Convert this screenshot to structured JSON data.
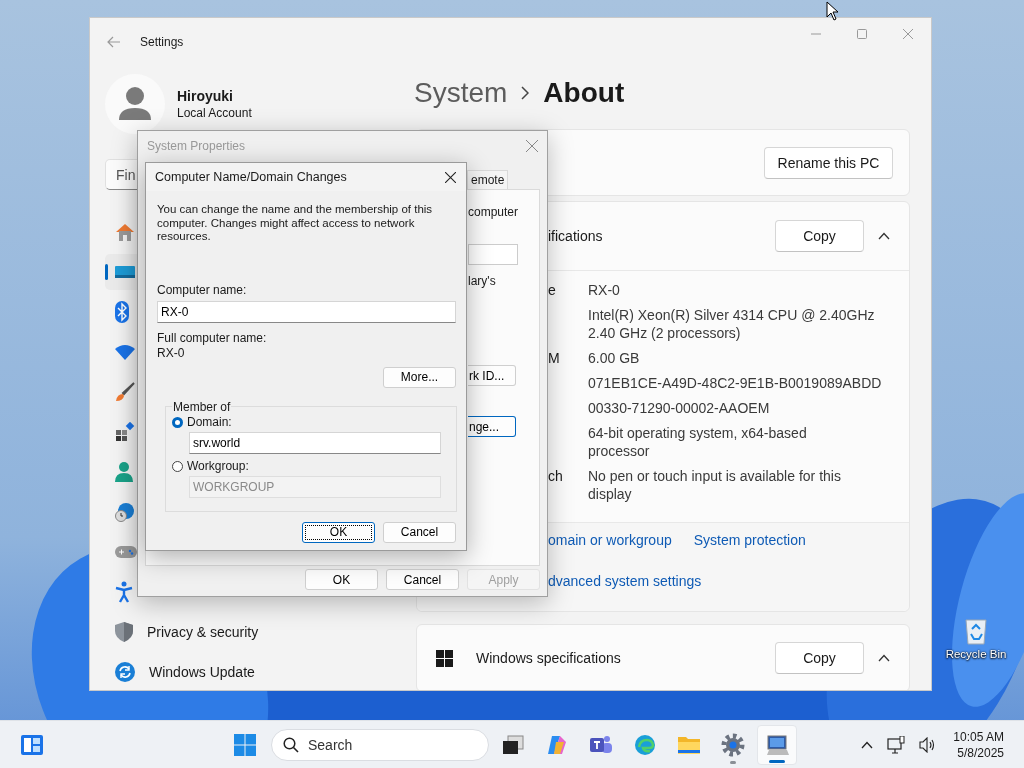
{
  "desktop": {
    "icons": [
      {
        "label": "Recycle Bin"
      }
    ]
  },
  "settings": {
    "title": "Settings",
    "user": {
      "name": "Hiroyuki",
      "account": "Local Account"
    },
    "search": {
      "placeholder": "Fin"
    },
    "nav": [
      {
        "kind": "home",
        "selected": false
      },
      {
        "kind": "system",
        "selected": true
      },
      {
        "kind": "bluetooth",
        "selected": false
      },
      {
        "kind": "network",
        "selected": false
      },
      {
        "kind": "personalization",
        "selected": false
      },
      {
        "kind": "apps",
        "selected": false
      },
      {
        "kind": "accounts",
        "selected": false
      },
      {
        "kind": "time",
        "selected": false
      },
      {
        "kind": "gaming",
        "selected": false
      },
      {
        "kind": "accessibility",
        "selected": false
      },
      {
        "kind": "privacy",
        "label": "Privacy & security",
        "selected": false
      },
      {
        "kind": "update",
        "label": "Windows Update",
        "selected": false
      }
    ],
    "breadcrumb": {
      "parent": "System",
      "current": "About"
    },
    "rename_button": "Rename this PC",
    "device_specs": {
      "title": "ifications",
      "copy_button": "Copy",
      "expanded": true,
      "rows": [
        {
          "label": "e",
          "value": [
            "RX-0"
          ]
        },
        {
          "value": [
            "Intel(R) Xeon(R) Silver 4314 CPU @ 2.40GHz",
            "2.40 GHz  (2 processors)"
          ]
        },
        {
          "label": "M",
          "value": [
            "6.00 GB"
          ]
        },
        {
          "value": [
            "071EB1CE-A49D-48C2-9E1B-B0019089ABDD"
          ]
        },
        {
          "value": [
            "00330-71290-00002-AAOEM"
          ]
        },
        {
          "value": [
            "64-bit operating system, x64-based",
            "processor"
          ]
        },
        {
          "label": "ch",
          "value": [
            "No pen or touch input is available for this",
            "display"
          ]
        }
      ],
      "link_rows": [
        {
          "links": [
            "omain or workgroup",
            "System protection"
          ]
        },
        {
          "links": [
            "dvanced system settings"
          ]
        }
      ]
    },
    "windows_specs": {
      "title": "Windows specifications",
      "copy_button": "Copy",
      "expanded": true
    }
  },
  "system_properties": {
    "title": "System Properties",
    "active": false,
    "tab": {
      "label": "emote",
      "selected": false
    },
    "description_fragment": "computer",
    "note_fragment": "lary's",
    "network_id_button": {
      "label": "rk ID...",
      "default": false
    },
    "change_button": {
      "label": "nge...",
      "default": true
    },
    "buttons": [
      {
        "label": "OK",
        "disabled": false
      },
      {
        "label": "Cancel",
        "disabled": false
      },
      {
        "label": "Apply",
        "disabled": true
      }
    ]
  },
  "dialog": {
    "title": "Computer Name/Domain Changes",
    "description": "You can change the name and the membership of this computer. Changes might affect access to network resources.",
    "computer_name_label": "Computer name:",
    "computer_name": "RX-0",
    "full_name_label": "Full computer name:",
    "full_name": "RX-0",
    "more_button": "More...",
    "member_of": {
      "legend": "Member of",
      "options": [
        {
          "label": "Domain:",
          "selected": true,
          "value": "srv.world"
        },
        {
          "label": "Workgroup:",
          "selected": false,
          "value": "WORKGROUP"
        }
      ]
    },
    "buttons": [
      {
        "label": "OK",
        "default": true
      },
      {
        "label": "Cancel",
        "default": false
      }
    ]
  },
  "taskbar": {
    "search_placeholder": "Search",
    "apps": [
      {
        "kind": "task-view",
        "running": false,
        "active": false
      },
      {
        "kind": "copilot",
        "running": false,
        "active": false
      },
      {
        "kind": "teams",
        "running": false,
        "active": false
      },
      {
        "kind": "edge",
        "running": false,
        "active": false
      },
      {
        "kind": "explorer",
        "running": false,
        "active": false
      },
      {
        "kind": "settings",
        "running": true,
        "active": false
      },
      {
        "kind": "system-properties",
        "running": true,
        "active": true
      }
    ],
    "clock": {
      "time": "10:05 AM",
      "date": "5/8/2025"
    }
  }
}
